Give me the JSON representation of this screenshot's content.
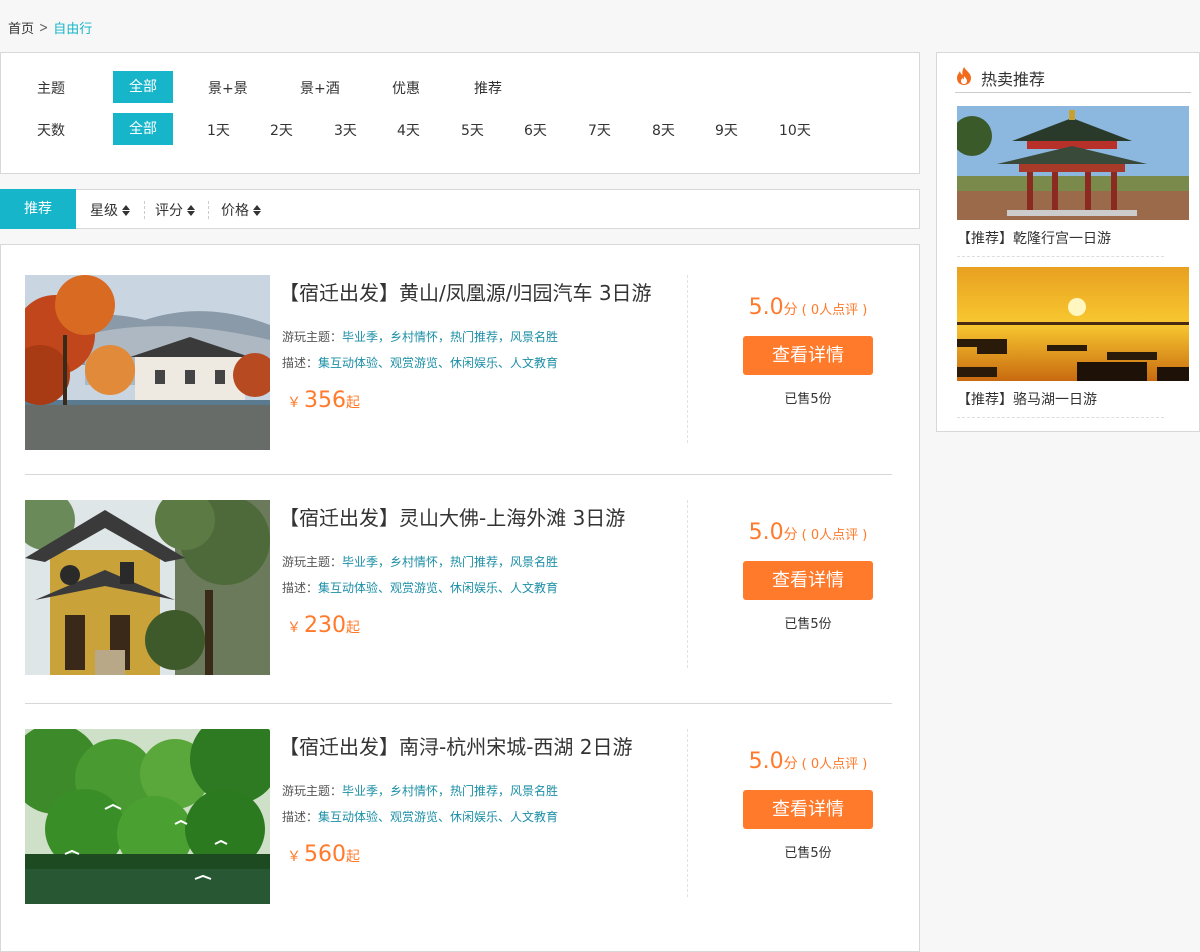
{
  "breadcrumb": {
    "home": "首页",
    "current": "自由行"
  },
  "filters": {
    "theme": {
      "label": "主题",
      "options": [
        "全部",
        "景+景",
        "景+酒",
        "优惠",
        "推荐"
      ]
    },
    "days": {
      "label": "天数",
      "options": [
        "全部",
        "1天",
        "2天",
        "3天",
        "4天",
        "5天",
        "6天",
        "7天",
        "8天",
        "9天",
        "10天"
      ]
    }
  },
  "sort": {
    "recommend": "推荐",
    "items": [
      "星级",
      "评分",
      "价格"
    ]
  },
  "tours": [
    {
      "title": "【宿迁出发】黄山/凤凰源/归园汽车 3日游",
      "theme_label": "游玩主题：",
      "theme_value": "毕业季，乡村情怀，热门推荐，风景名胜",
      "desc_label": "描述：",
      "desc_value": "集互动体验、观赏游览、休闲娱乐、人文教育",
      "yen": "￥",
      "price": "356",
      "qi": "起",
      "score": "5.0",
      "score_unit": "分",
      "reviews": "( 0人点评 )",
      "btn": "查看详情",
      "sold": "已售5份"
    },
    {
      "title": "【宿迁出发】灵山大佛-上海外滩 3日游",
      "theme_label": "游玩主题：",
      "theme_value": "毕业季，乡村情怀，热门推荐，风景名胜",
      "desc_label": "描述：",
      "desc_value": "集互动体验、观赏游览、休闲娱乐、人文教育",
      "yen": "￥",
      "price": "230",
      "qi": "起",
      "score": "5.0",
      "score_unit": "分",
      "reviews": "( 0人点评 )",
      "btn": "查看详情",
      "sold": "已售5份"
    },
    {
      "title": "【宿迁出发】南浔-杭州宋城-西湖 2日游",
      "theme_label": "游玩主题：",
      "theme_value": "毕业季，乡村情怀，热门推荐，风景名胜",
      "desc_label": "描述：",
      "desc_value": "集互动体验、观赏游览、休闲娱乐、人文教育",
      "yen": "￥",
      "price": "560",
      "qi": "起",
      "score": "5.0",
      "score_unit": "分",
      "reviews": "( 0人点评 )",
      "btn": "查看详情",
      "sold": "已售5份"
    }
  ],
  "sidebar": {
    "title": "热卖推荐",
    "icon": "fire-icon",
    "items": [
      {
        "caption": "【推荐】乾隆行宫一日游"
      },
      {
        "caption": "【推荐】骆马湖一日游"
      }
    ]
  },
  "colors": {
    "accent": "#17b5c9",
    "orange": "#ff7a2b",
    "link": "#1c8fa6"
  }
}
